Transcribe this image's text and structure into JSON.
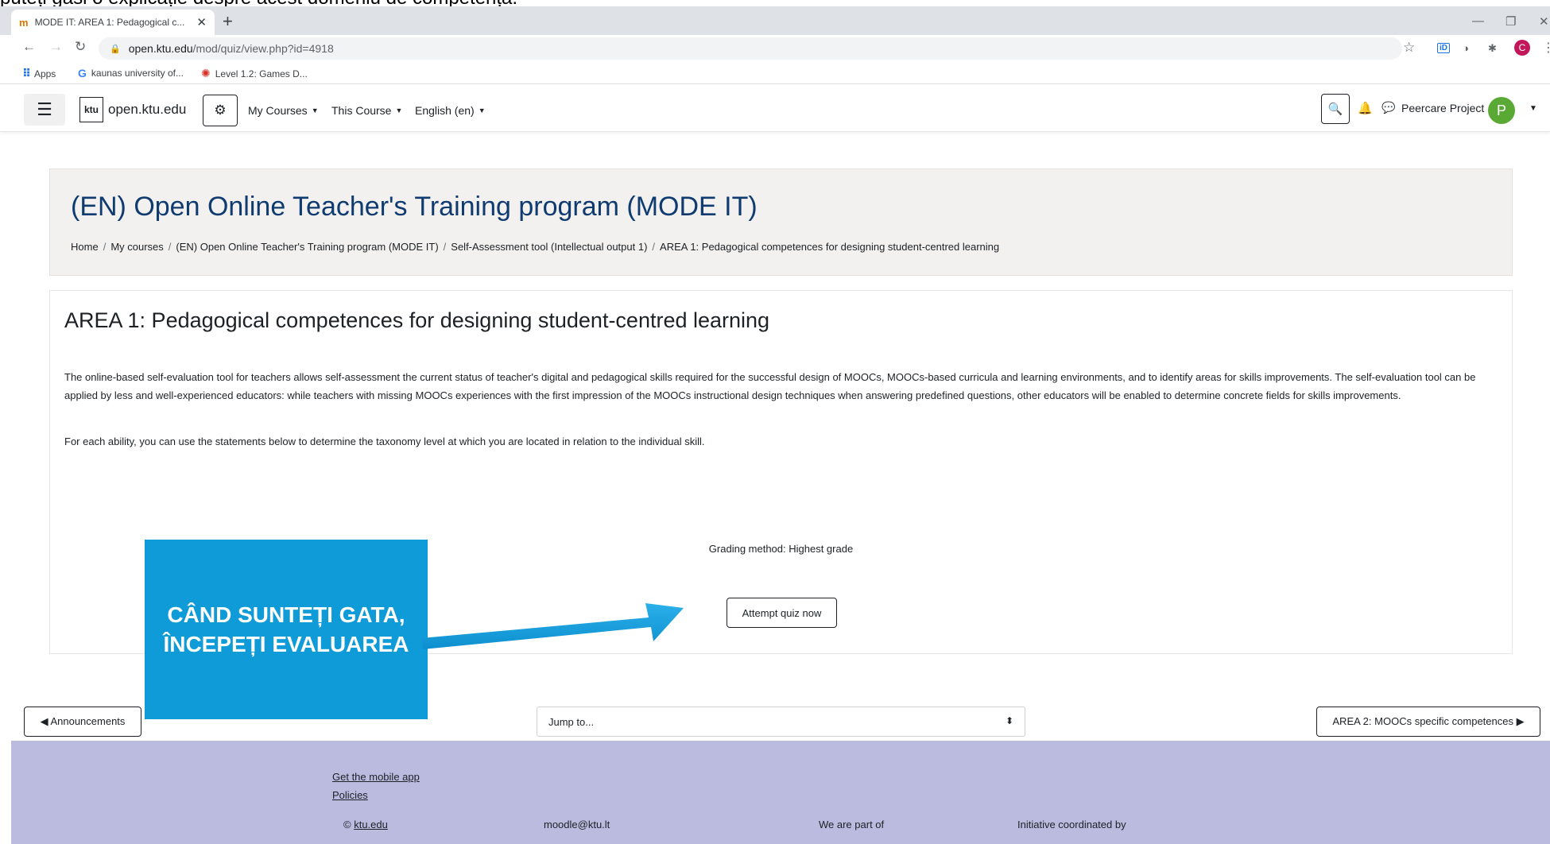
{
  "slide_caption": "puteți găsi o explicație despre acest domeniu de competență.",
  "browser": {
    "tab_title": "MODE IT: AREA 1: Pedagogical c...",
    "url_host": "open.ktu.edu",
    "url_path": "/mod/quiz/view.php?id=4918",
    "bookmarks": [
      "Apps",
      "kaunas university of...",
      "Level 1.2: Games D..."
    ],
    "profile_letter": "C"
  },
  "navbar": {
    "site_name": "open.ktu.edu",
    "logo_text": "ktu",
    "menus": [
      "My Courses",
      "This Course",
      "English (en)"
    ],
    "user_name": "Peercare Project",
    "avatar_letter": "P"
  },
  "header": {
    "title": "(EN) Open Online Teacher's Training program (MODE IT)",
    "breadcrumb": [
      "Home",
      "My courses",
      "(EN) Open Online Teacher's Training program (MODE IT)",
      "Self-Assessment tool (Intellectual output 1)",
      "AREA 1: Pedagogical competences for designing student-centred learning"
    ]
  },
  "main": {
    "heading": "AREA 1: Pedagogical competences for designing student-centred learning",
    "paragraph1": "The online-based self-evaluation tool for teachers allows self-assessment the current status of teacher's digital and pedagogical skills required for the successful design of MOOCs, MOOCs-based curricula and learning environments, and to identify areas for skills improvements. The self-evaluation tool can be applied by less and well-experienced educators: while teachers with missing MOOCs experiences with the first impression of the MOOCs instructional design techniques when answering predefined questions, other educators will be enabled to determine concrete fields for skills improvements.",
    "paragraph2": "For each ability, you can use the statements below to determine the taxonomy level at which you are located in relation to the individual skill.",
    "grading": "Grading method: Highest grade",
    "attempt_label": "Attempt quiz now"
  },
  "bottom_nav": {
    "prev_label": "◀ Announcements",
    "jump_label": "Jump to...",
    "next_label": "AREA 2: MOOCs specific competences ▶"
  },
  "footer": {
    "mobile_app": "Get the mobile app",
    "policies": "Policies",
    "copyright_prefix": "© ",
    "copyright_link": "ktu.edu",
    "email": "moodle@ktu.lt",
    "part_of": "We are part of",
    "coordinated": "Initiative coordinated by"
  },
  "callout": {
    "text": "CÂND SUNTEȚI GATA, ÎNCEPEȚI EVALUAREA",
    "color": "#0f9ad8"
  }
}
